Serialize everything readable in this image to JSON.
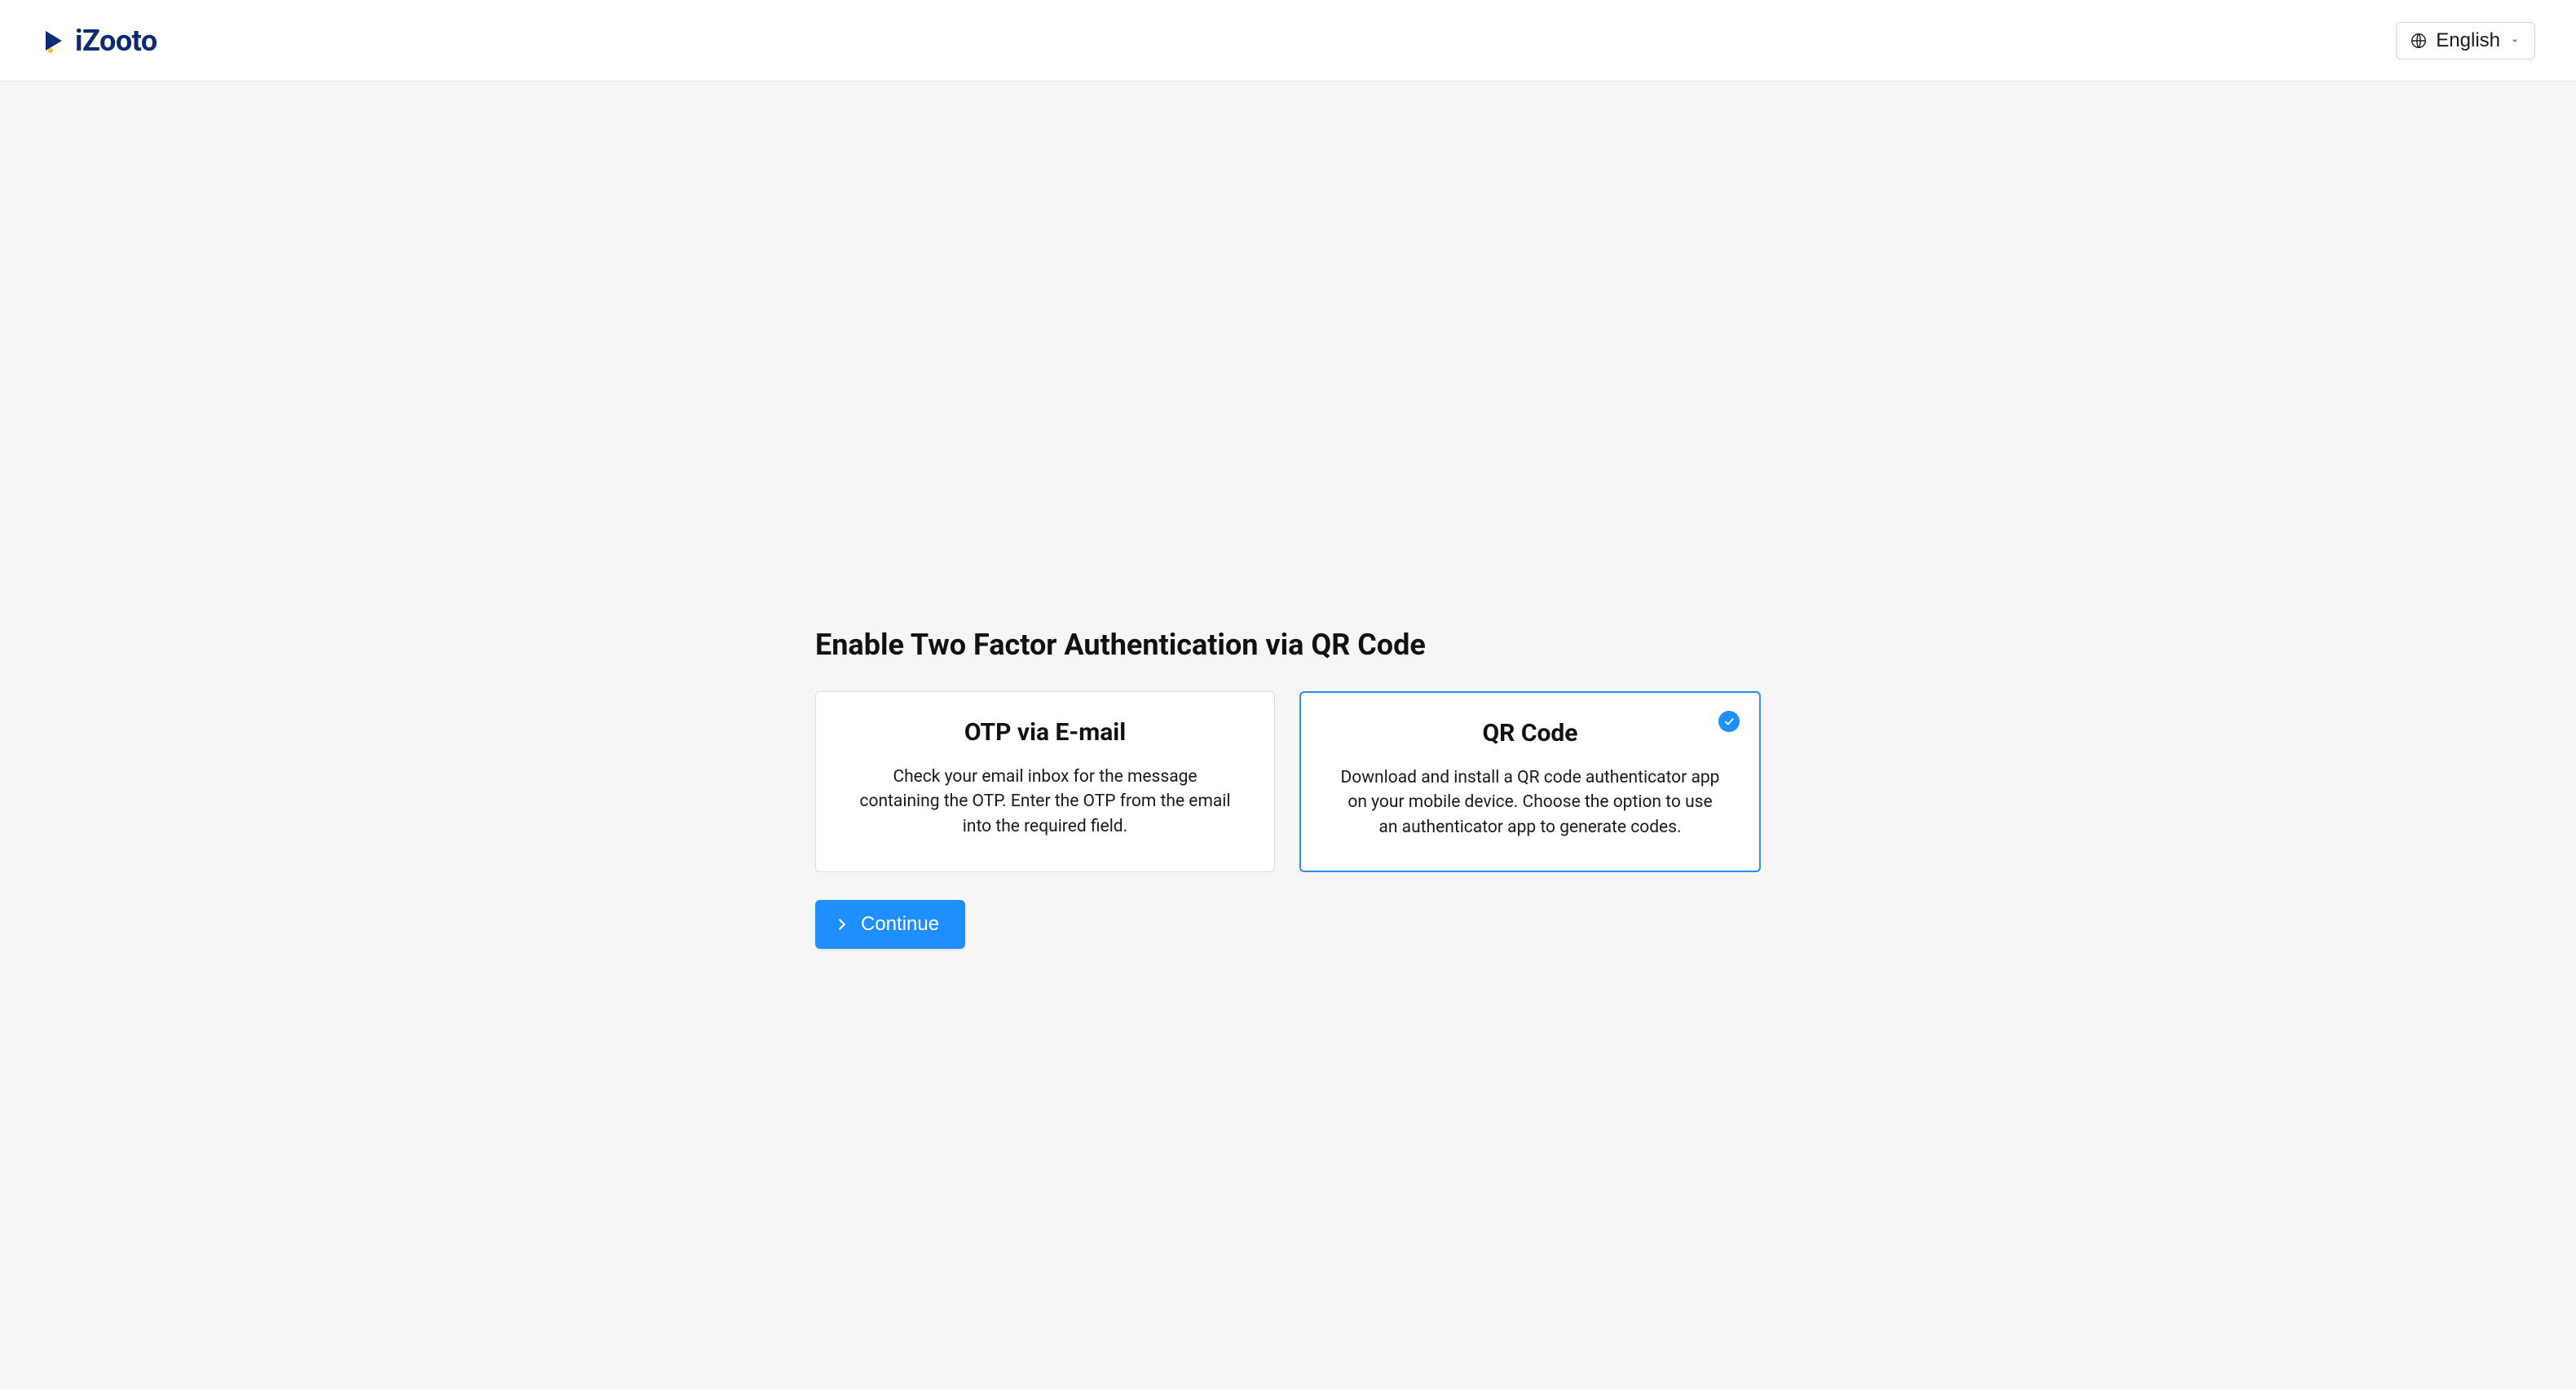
{
  "header": {
    "brand": "iZooto",
    "language_label": "English"
  },
  "main": {
    "title": "Enable Two Factor Authentication via QR Code",
    "options": [
      {
        "title": "OTP via E-mail",
        "description": "Check your email inbox for the message containing the OTP. Enter the OTP from the email into the required field.",
        "selected": false
      },
      {
        "title": "QR Code",
        "description": "Download and install a QR code authenticator app on your mobile device. Choose the option to use an authenticator app to generate codes.",
        "selected": true
      }
    ],
    "continue_label": "Continue"
  }
}
